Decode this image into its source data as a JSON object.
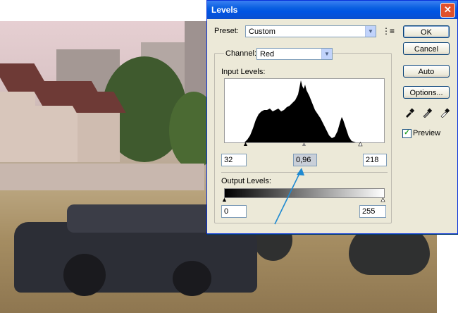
{
  "dialog": {
    "title": "Levels",
    "preset": {
      "label": "Preset:",
      "value": "Custom"
    },
    "channel": {
      "label": "Channel:",
      "value": "Red"
    },
    "input_levels": {
      "label": "Input Levels:",
      "black": "32",
      "gamma": "0,96",
      "white": "218"
    },
    "output_levels": {
      "label": "Output Levels:",
      "black": "0",
      "white": "255"
    },
    "buttons": {
      "ok": "OK",
      "cancel": "Cancel",
      "auto": "Auto",
      "options": "Options..."
    },
    "preview": {
      "label": "Preview",
      "checked": true
    },
    "colors": {
      "titlebar": "#0054e3",
      "annotation_arrow": "#1f8ad1"
    }
  }
}
